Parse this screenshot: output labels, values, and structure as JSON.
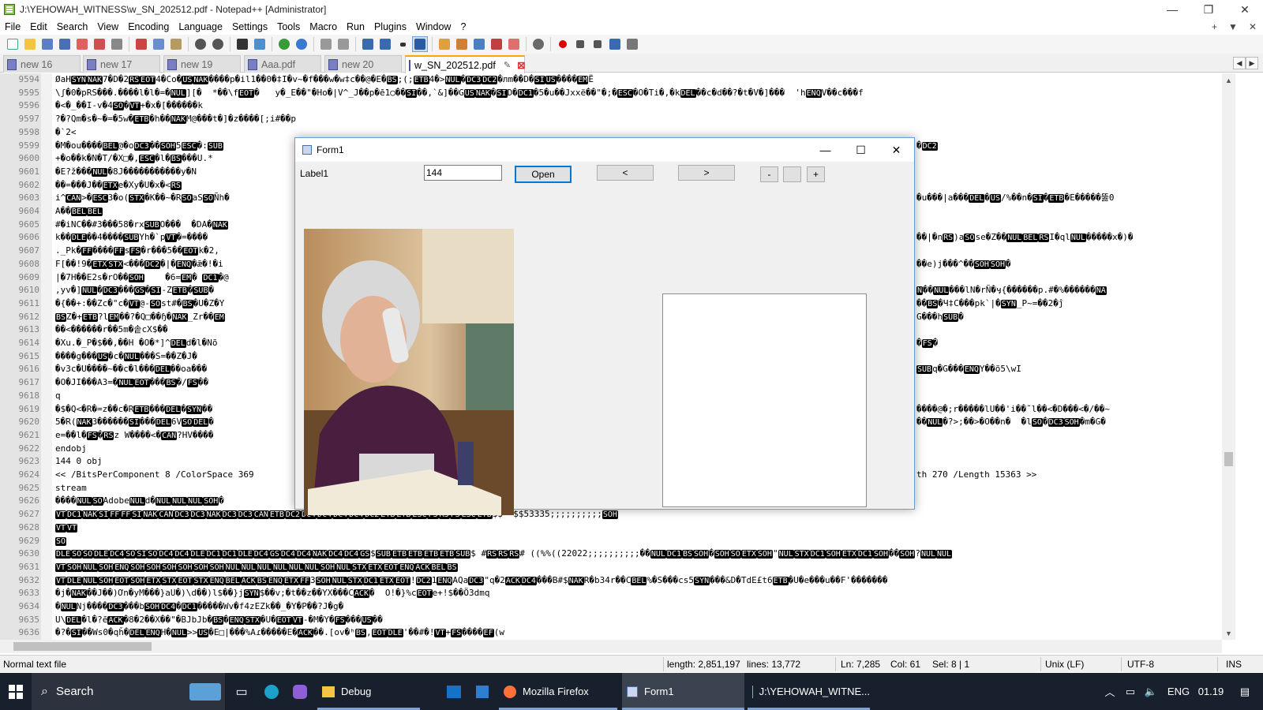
{
  "window": {
    "title": "J:\\YEHOWAH_WITNESS\\w_SN_202512.pdf - Notepad++ [Administrator]",
    "min": "—",
    "max": "❐",
    "close": "✕"
  },
  "menu": [
    "File",
    "Edit",
    "Search",
    "View",
    "Encoding",
    "Language",
    "Settings",
    "Tools",
    "Macro",
    "Run",
    "Plugins",
    "Window",
    "?"
  ],
  "menu_right": {
    "plus": "+",
    "down": "▼",
    "close": "✕"
  },
  "tabs": [
    {
      "label": "new 16"
    },
    {
      "label": "new 17"
    },
    {
      "label": "new 19"
    },
    {
      "label": "Aaa.pdf"
    },
    {
      "label": "new 20"
    },
    {
      "label": "w_SN_202512.pdf",
      "active": true
    }
  ],
  "tab_nav": {
    "prev": "◀",
    "next": "▶"
  },
  "editor": {
    "lines": [
      {
        "n": "9594",
        "t": "ØaH[SYN][NAK]7�D�2[RS][EOT]4�Co�[US][NAK]����p�il1��0�‡I�v~�f���w�w‡c��@�E�[BS];(;[ETB]4�>[NUL]�[DC3][DC2]�лm��D�[SI][US]����[EM]Ë"
      },
      {
        "n": "9595",
        "t": "\\ʃ�0�pRS���.����l�l�=�[NUL]][�  *��\\f[EOT]�   y�_E��\"�Ho�|V^_J��p�ē1○��[SI]��,`&]��G[US][NAK]�[SI]D�[DC1]�5�u��Jxxë��\"�;�[ESC]�O�Ti�,�k[DEL]��c�d��?�t�V�]���  'h[ENQ]V��c���f"
      },
      {
        "n": "9596",
        "t": "�<�_��I-v�4[SO]�[VT]+�x�[������k"
      },
      {
        "n": "9597",
        "t": "?�?Qm�s�~�=�5w�[ETB]�h��[NAK]M@���t�]�z����[;i#��p"
      },
      {
        "n": "9598",
        "t": "�`2<"
      },
      {
        "n": "9599",
        "t": "�M�ou����[BEL]@�o[DC3]��[SOH]5[ESC]�:[SUB]"
      },
      {
        "n": "9600",
        "t": "+�o��k�N�T/�X□�,[ESC]�l�[BS]���U.*"
      },
      {
        "n": "9601",
        "t": "�E?ž���[NUL]�8J�����������y�N"
      },
      {
        "n": "9602",
        "t": "��=���J��[ETX]e�Xy�U�x�<[RS]"
      },
      {
        "n": "9603",
        "t": "i^[CAN]>�[ESC]3�o([STX]�K��~�R[SO]aS[SO]Ñh�"
      },
      {
        "n": "9604",
        "t": "A��[BEL][BEL]"
      },
      {
        "n": "9605",
        "t": "#�iNC��#3���58�rx[SUB]O���  �DA�[NAK]"
      },
      {
        "n": "9606",
        "t": "k��[DLE]��4����[SUB]Yh�`p[VT]�=����"
      },
      {
        "n": "9607",
        "t": "._Pk�[FF]����[FF]s[FS]�r���5��[EOT]k�2,"
      },
      {
        "n": "9608",
        "t": "F[��!9�[ETX][STX]<���[DC2]�|�[ENQ]�ǣ�!�i"
      },
      {
        "n": "9609",
        "t": "|�7H��E2s�rO��[SOH]    �6=[EM]� [DC1]�@"
      },
      {
        "n": "9610",
        "t": ",yv�][NUL]�[DC3]���[GS]�[SI]-Z[ETB]�[SUB]�"
      },
      {
        "n": "9611",
        "t": "�{��+:��Zc�\"c�[VT]@-[SO]st#�[BS]�U�Z�Y"
      },
      {
        "n": "9612",
        "t": "[BS]Z�+[ETB]?l[EM]��?�Q□��ɧ�[NAK]_Zr��[EM]"
      },
      {
        "n": "9613",
        "t": "��<������r��5m�솥cX$��"
      },
      {
        "n": "9614",
        "t": "�Xu.�_P�$��,��H �O�*]^[DEL]d�l�Nõ"
      },
      {
        "n": "9615",
        "t": "����g���[US]�c�[NUL]���S=��Z�J�"
      },
      {
        "n": "9616",
        "t": "�v3c�U����~��c�l���[DEL]��oa���"
      },
      {
        "n": "9617",
        "t": "�O�JI���A3=�[NUL][EOT]���[BS]�/[FS]��"
      },
      {
        "n": "9618",
        "t": "q"
      },
      {
        "n": "9619",
        "t": "�$�Q<�R�=z��c�R[ETB]���[DEL]�[SYN]��"
      },
      {
        "n": "9620",
        "t": "5�R([NAK]3������[SI]���[DEL]6V[SO][DEL]�"
      },
      {
        "n": "9621",
        "t": "e=��l�[FS]�[RS]z W����<�[CAN]?HV����"
      },
      {
        "n": "9622",
        "t": "endobj"
      },
      {
        "n": "9623",
        "t": "144 0 obj"
      },
      {
        "n": "9624",
        "t": "<< /BitsPerComponent 8 /ColorSpace 369"
      },
      {
        "n": "9625",
        "t": "stream"
      },
      {
        "n": "9626",
        "t": "����[NUL][SO]Adobe[NUL]d�[NUL][NUL][NUL][SOH]�"
      },
      {
        "n": "9627",
        "t": "[VT][DC1][NAK][SI][FF][FF][SI][NAK][CAN][DC3][DC3][NAK][DC3][DC3][CAN][ETB][DC2][DC4][DC4][DC4][DC4][DC2][ETB][ETB][ESC][FS][RS][FS][ESC][ETB]$$''$$53335;;;;;;;;;;[SOH]"
      },
      {
        "n": "9628",
        "t": "[VT][VT]"
      },
      {
        "n": "9629",
        "t": "[SO]"
      },
      {
        "n": "9630",
        "t": "[DLE][SO][SO][DLE][DC4][SO][SI][SO][DC4][DC4][DLE][DC1][DC1][DLE][DC4][GS][DC4][DC4][NAK][DC4][DC4][GS]$[SUB][ETB][ETB][ETB][ETB][SUB]$ #[RS][RS][RS]# ((%%((22022;;;;;;;;;;��[NUL][DC1][BS][SOH]�[SOH][SO][ETX][SOH]\"[NUL][STX][DC1][SOH][ETX][DC1][SOH]��[SOH]?[NUL][NUL]"
      },
      {
        "n": "9631",
        "t": "[VT][SOH][NUL][SOH][ENQ][SOH][SOH][SOH][SOH][SOH][SOH][NUL][NUL][NUL][NUL][NUL][NUL][SOH][NUL][STX][ETX][EOT][ENQ][ACK][BEL][BS]"
      },
      {
        "n": "9632",
        "t": "[VT][DLE][NUL][SOH][EOT][SOH][ETX][STX][EOT][STX][ENQ][BEL][ACK][BS][ENQ][ETX][FF]3[SOH][NUL][STX][DC1][ETX][EOT]![DC2]1[ENQ]AQa[DC3]\"q�2[ACK][DC4]���B#$[NAK]R�b34r��C[BEL]%�S���cs5[SYN]���&D�TdE£t6[ETB]�U�e���u��F'�������"
      },
      {
        "n": "9633",
        "t": "�j�[NAK]��J��)Ơn�yM���}aU�)\\d��)l$��}j[SYN]$��v;�t��z��YX���C[ACK]�  O!�}%c[EOT]e+!$��Ö3dmq"
      },
      {
        "n": "9634",
        "t": "�[NUL]Nj����[DC3]���b[SOH][DC4]�[DC1]�����Wv�f4zEZk��_�Y�P��?J�g�"
      },
      {
        "n": "9635",
        "t": "U\\[DEL]�l�?ē[ACK]�8�2��X��\"�BJbJb�[BS]�[ENQ][STX]�U�[EOT][VT]-�M�Y�[FS]���[US]��"
      },
      {
        "n": "9636",
        "t": "�?�[SI]��Ws0�qȟ�[DEL][ENQ]H�[NUL]>>[US]�E□|���%Aɾ�����E�[ACK]��.[ov�ʰ[BS],[EOT][DLE]'��#�![VT]+[FS]����[EF](w"
      }
    ],
    "right_fragments": [
      {
        "n": "9599",
        "t": "�[DC2]"
      },
      {
        "n": "9603",
        "t": "�u���|a���[DEL]�[US]/%��n�[SI]�[ETB]�E�����뚫0"
      },
      {
        "n": "9606",
        "t": "��|�n[RS])a[SO]se�Z��[NUL][BEL][RS]I�ql[NUL]�����x�)�"
      },
      {
        "n": "9608",
        "t": "��e)j���^��[SOH][SOH]�"
      },
      {
        "n": "9610",
        "t": "[N]��[NUL]���lN�rÑ�ӌ{������p.#�%������[NA]"
      },
      {
        "n": "9611",
        "t": "��[BS]�Ч‡C���pk`|�[SYN]_P~=��2�ĵ"
      },
      {
        "n": "9612",
        "t": "G���h[SUB]�"
      },
      {
        "n": "9614",
        "t": "�[FS]�"
      },
      {
        "n": "9616",
        "t": "[SUB]q�G���[ENQ]Y��õ5\\wI"
      },
      {
        "n": "9619",
        "t": "����@�;r�����lU��'i��˜l��<�D���<�/��~"
      },
      {
        "n": "9620",
        "t": "��[NUL]�?>;��>�O��n�  �l[SO]�[DC3][SOH]�m�G�"
      },
      {
        "n": "9624",
        "t": "th 270 /Length 15363 >>"
      }
    ]
  },
  "status": {
    "type": "Normal text file",
    "length": "length: 2,851,197",
    "lines": "lines: 13,772",
    "ln": "Ln: 7,285",
    "col": "Col: 61",
    "sel": "Sel: 8 | 1",
    "eol": "Unix (LF)",
    "enc": "UTF-8",
    "ins": "INS"
  },
  "form1": {
    "title": "Form1",
    "label": "Label1",
    "input_value": "144",
    "open_label": "Open",
    "prev_label": "<",
    "next_label": ">",
    "minus_label": "-",
    "plus_label": "+",
    "win_min": "—",
    "win_max": "☐",
    "win_close": "✕"
  },
  "taskbar": {
    "search_label": "Search",
    "items": [
      "Debug",
      "Mozilla Firefox",
      "Form1",
      "J:\\YEHOWAH_WITNE..."
    ],
    "lang": "ENG",
    "time": "01.19"
  }
}
